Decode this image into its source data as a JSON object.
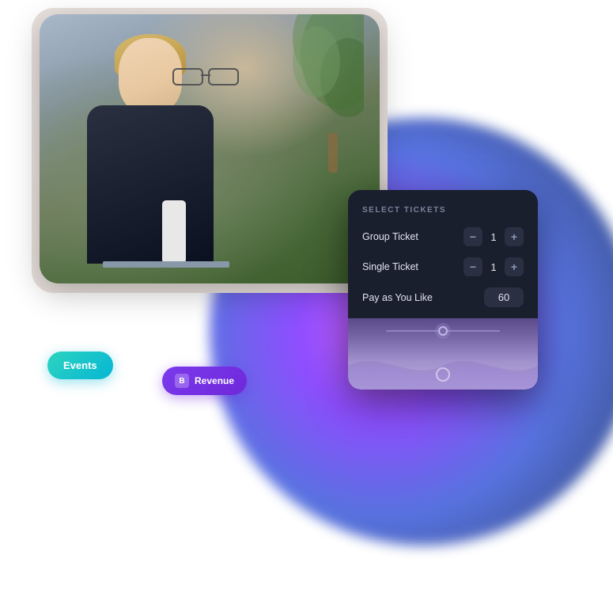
{
  "scene": {
    "background": {
      "glow_colors": [
        "#c84aff",
        "#7b2fff",
        "#3b5bdb",
        "#1e3a8a"
      ]
    },
    "photo": {
      "alt": "Woman with glasses at laptop"
    },
    "ticket_card": {
      "title": "SELECT TICKETS",
      "rows": [
        {
          "label": "Group Ticket",
          "type": "stepper",
          "value": "1",
          "minus_label": "−",
          "plus_label": "+"
        },
        {
          "label": "Single Ticket",
          "type": "stepper",
          "value": "1",
          "minus_label": "−",
          "plus_label": "+"
        },
        {
          "label": "Pay as You Like",
          "type": "input",
          "value": "60"
        }
      ]
    },
    "events_badge": {
      "label": "Events"
    },
    "revenue_badge": {
      "icon": "B",
      "label": "Revenue"
    }
  }
}
